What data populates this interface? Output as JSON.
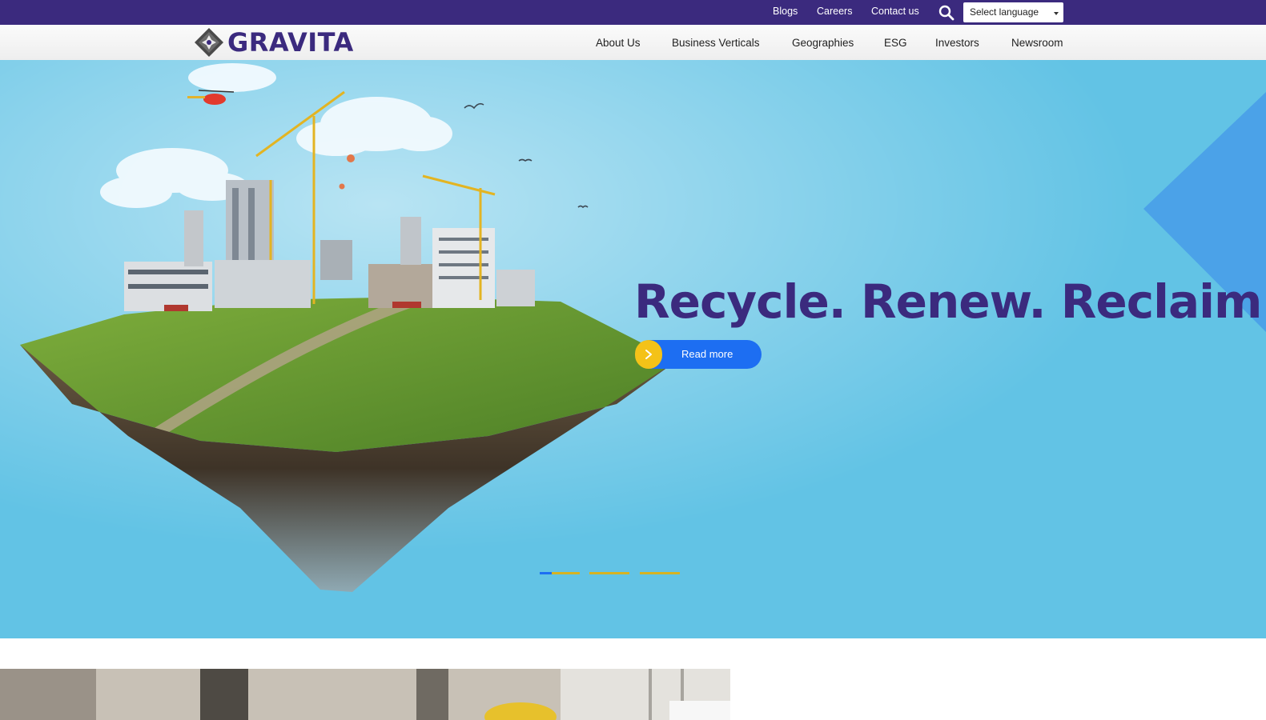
{
  "topbar": {
    "links": [
      "Blogs",
      "Careers",
      "Contact us"
    ],
    "search_icon": "search-icon",
    "language_select": {
      "value": "Select language"
    }
  },
  "header": {
    "logo_text": "GRAVITA",
    "nav": [
      "About Us",
      "Business Verticals",
      "Geographies",
      "ESG",
      "Investors",
      "Newsroom"
    ]
  },
  "hero": {
    "headline": "Recycle. Renew. Reclaim.",
    "cta_label": "Read more",
    "slides_total": 3,
    "active_slide": 1
  },
  "colors": {
    "brand_purple": "#3b2a7e",
    "sky_blue": "#62c3e5",
    "cta_blue": "#1d6ef2",
    "accent_yellow": "#f4c218"
  }
}
